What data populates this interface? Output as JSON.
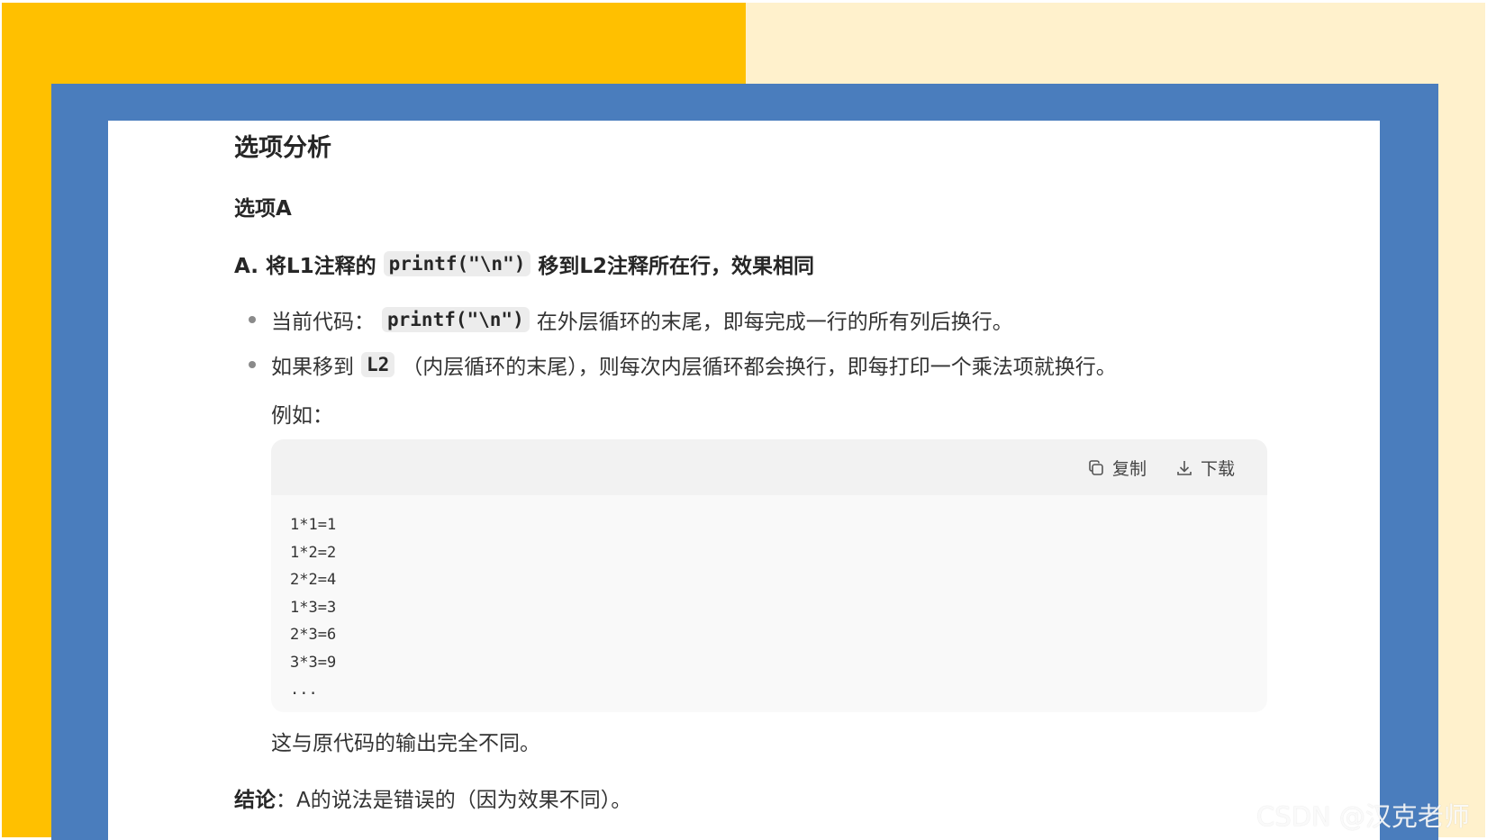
{
  "section_title": "选项分析",
  "option_title": "选项A",
  "statement": {
    "prefix": "A. 将L1注释的",
    "code": "printf(\"\\n\")",
    "suffix": "移到L2注释所在行，效果相同"
  },
  "bullets": [
    {
      "prefix": "当前代码：",
      "code": "printf(\"\\n\")",
      "suffix": "在外层循环的末尾，即每完成一行的所有列后换行。"
    },
    {
      "prefix": "如果移到",
      "code": "L2",
      "suffix": "（内层循环的末尾），则每次内层循环都会换行，即每打印一个乘法项就换行。"
    }
  ],
  "example_label": "例如：",
  "code_block": {
    "copy_label": "复制",
    "download_label": "下载",
    "lines": [
      "1*1=1",
      "1*2=2",
      "2*2=4",
      "1*3=3",
      "2*3=6",
      "3*3=9",
      "..."
    ]
  },
  "after_text": "这与原代码的输出完全不同。",
  "conclusion": {
    "label": "结论",
    "text": "：A的说法是错误的（因为效果不同）。"
  },
  "watermark": "CSDN @汉克老师",
  "colors": {
    "background_left": "#ffc000",
    "background_right": "#fff1cc",
    "frame": "#4a7dbd"
  }
}
